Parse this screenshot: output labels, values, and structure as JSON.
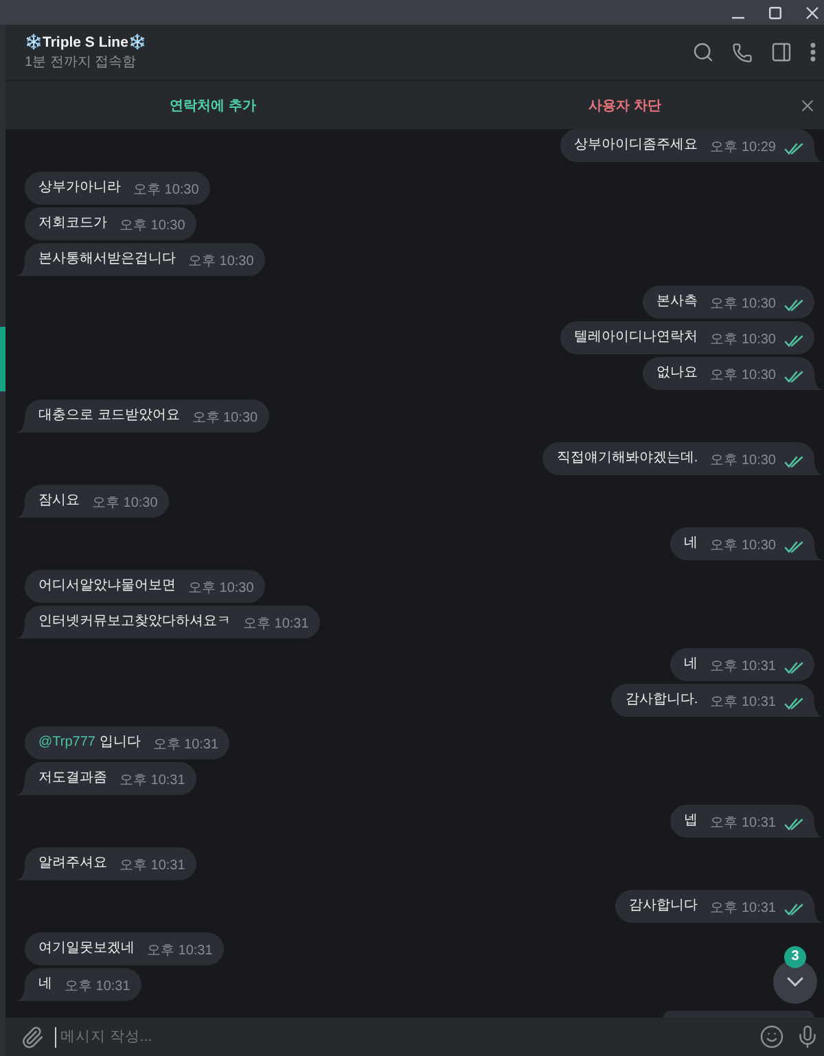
{
  "chat": {
    "title": "❄️Triple S Line❄️",
    "status": "1분 전까지 접속함"
  },
  "action_bar": {
    "buttons": [
      {
        "label": "연락처에 추가",
        "color": "#4fd1a5"
      },
      {
        "label": "사용자 차단",
        "color": "#e8747b"
      }
    ]
  },
  "messages": [
    {
      "kind": "text",
      "outgoing": true,
      "text": "상부아이디좀주세요",
      "time": "오후 10:29",
      "read": true
    },
    {
      "kind": "text",
      "outgoing": false,
      "text": "상부가아니라",
      "time": "오후 10:30"
    },
    {
      "kind": "text",
      "outgoing": false,
      "text": "저회코드가",
      "time": "오후 10:30"
    },
    {
      "kind": "text",
      "outgoing": false,
      "text": "본사통해서받은겁니다",
      "time": "오후 10:30"
    },
    {
      "kind": "text",
      "outgoing": true,
      "text": "본사측",
      "time": "오후 10:30",
      "read": true
    },
    {
      "kind": "text",
      "outgoing": true,
      "text": "텔레아이디나연락처",
      "time": "오후 10:30",
      "read": true
    },
    {
      "kind": "text",
      "outgoing": true,
      "text": "없나요",
      "time": "오후 10:30",
      "read": true
    },
    {
      "kind": "text",
      "outgoing": false,
      "text": "대충으로 코드받았어요",
      "time": "오후 10:30"
    },
    {
      "kind": "text",
      "outgoing": true,
      "text": "직접얘기해봐야겠는데.",
      "time": "오후 10:30",
      "read": true
    },
    {
      "kind": "text",
      "outgoing": false,
      "text": "잠시요",
      "time": "오후 10:30"
    },
    {
      "kind": "text",
      "outgoing": true,
      "text": "네",
      "time": "오후 10:30",
      "read": true
    },
    {
      "kind": "text",
      "outgoing": false,
      "text": "어디서알았냐물어보면",
      "time": "오후 10:30"
    },
    {
      "kind": "text",
      "outgoing": false,
      "text": "인터넷커뮤보고찾았다하셔요ㅋ",
      "time": "오후 10:31"
    },
    {
      "kind": "text",
      "outgoing": true,
      "text": "네",
      "time": "오후 10:31",
      "read": true
    },
    {
      "kind": "text",
      "outgoing": true,
      "text": "감사합니다.",
      "time": "오후 10:31",
      "read": true
    },
    {
      "kind": "text",
      "outgoing": false,
      "mention": "@Trp777",
      "text": "입니다",
      "time": "오후 10:31"
    },
    {
      "kind": "text",
      "outgoing": false,
      "text": "저도결과좀",
      "time": "오후 10:31"
    },
    {
      "kind": "text",
      "outgoing": true,
      "text": "넵",
      "time": "오후 10:31",
      "read": true
    },
    {
      "kind": "text",
      "outgoing": false,
      "text": "알려주셔요",
      "time": "오후 10:31"
    },
    {
      "kind": "text",
      "outgoing": true,
      "text": "감사합니다",
      "time": "오후 10:31",
      "read": true
    },
    {
      "kind": "text",
      "outgoing": false,
      "text": "여기일못보겠네",
      "time": "오후 10:31"
    },
    {
      "kind": "text",
      "outgoing": false,
      "text": "네",
      "time": "오후 10:31"
    },
    {
      "kind": "partial",
      "outgoing": true
    }
  ],
  "scroll_button": {
    "unread": "3"
  },
  "composer": {
    "placeholder": "메시지 작성..."
  }
}
